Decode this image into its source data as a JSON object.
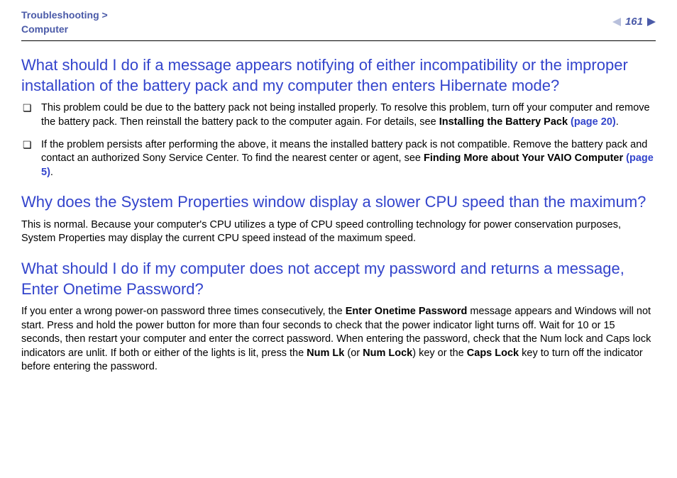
{
  "header": {
    "breadcrumb_line1": "Troubleshooting >",
    "breadcrumb_line2": "Computer",
    "page_number": "161"
  },
  "sections": [
    {
      "heading": "What should I do if a message appears notifying of either incompatibility or the improper installation of the battery pack and my computer then enters Hibernate mode?",
      "bullets": [
        {
          "pre": "This problem could be due to the battery pack not being installed properly. To resolve this problem, turn off your computer and remove the battery pack. Then reinstall the battery pack to the computer again. For details, see ",
          "bold": "Installing the Battery Pack",
          "link": " (page 20)",
          "post": "."
        },
        {
          "pre": "If the problem persists after performing the above, it means the installed battery pack is not compatible. Remove the battery pack and contact an authorized Sony Service Center. To find the nearest center or agent, see ",
          "bold": "Finding More about Your VAIO Computer",
          "link": " (page 5)",
          "post": "."
        }
      ]
    },
    {
      "heading": "Why does the System Properties window display a slower CPU speed than the maximum?",
      "paragraph": "This is normal. Because your computer's CPU utilizes a type of CPU speed controlling technology for power conservation purposes, System Properties may display the current CPU speed instead of the maximum speed."
    },
    {
      "heading": "What should I do if my computer does not accept my password and returns a message, Enter Onetime Password?",
      "paragraph_parts": {
        "p1": "If you enter a wrong power-on password three times consecutively, the ",
        "b1": "Enter Onetime Password",
        "p2": " message appears and Windows will not start. Press and hold the power button for more than four seconds to check that the power indicator light turns off. Wait for 10 or 15 seconds, then restart your computer and enter the correct password. When entering the password, check that the Num lock and Caps lock indicators are unlit. If both or either of the lights is lit, press the ",
        "b2": "Num Lk",
        "p3": " (or ",
        "b3": "Num Lock",
        "p4": ") key or the ",
        "b4": "Caps Lock",
        "p5": " key to turn off the indicator before entering the password."
      }
    }
  ]
}
